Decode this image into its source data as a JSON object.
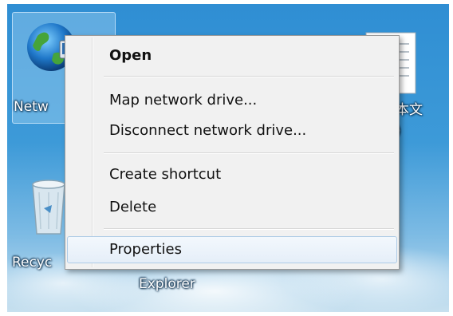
{
  "desktop": {
    "icons": {
      "network_label": "Netw",
      "recycle_label": "Recyc",
      "explorer_label": "Explorer",
      "doc_label_line1": "本文",
      "doc_label_line2": ")"
    }
  },
  "context_menu": {
    "items": [
      {
        "label": "Open",
        "bold": true
      },
      {
        "label": "Map network drive..."
      },
      {
        "label": "Disconnect network drive..."
      },
      {
        "label": "Create shortcut"
      },
      {
        "label": "Delete"
      },
      {
        "label": "Properties",
        "highlighted": true
      }
    ]
  },
  "icons": [
    "network-globe-icon",
    "recycle-bin-icon",
    "text-document-icon"
  ],
  "colors": {
    "menu_background": "#f1f1f1",
    "menu_border": "#9a9a9a",
    "highlight_border": "#aecbe6",
    "desktop_sky": "#3d9ad8"
  }
}
